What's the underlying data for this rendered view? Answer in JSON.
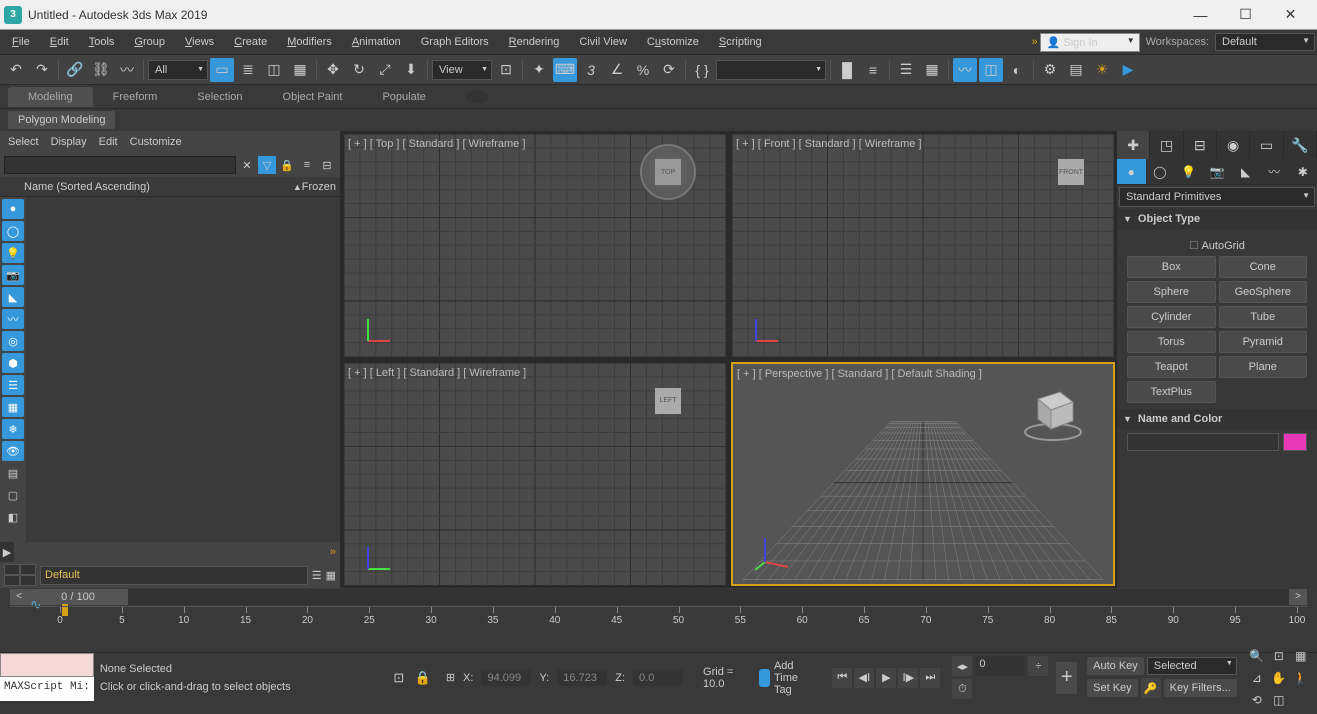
{
  "title": "Untitled - Autodesk 3ds Max 2019",
  "app_icon_text": "3",
  "menu": [
    "File",
    "Edit",
    "Tools",
    "Group",
    "Views",
    "Create",
    "Modifiers",
    "Animation",
    "Graph Editors",
    "Rendering",
    "Civil View",
    "Customize",
    "Scripting"
  ],
  "sign_in": "Sign In",
  "workspace_label": "Workspaces:",
  "workspace_value": "Default",
  "main_toolbar": {
    "all_dropdown": "All",
    "view_dropdown": "View"
  },
  "ribbon_tabs": [
    "Modeling",
    "Freeform",
    "Selection",
    "Object Paint",
    "Populate"
  ],
  "sub_ribbon": "Polygon Modeling",
  "scene_explorer": {
    "menu": [
      "Select",
      "Display",
      "Edit",
      "Customize"
    ],
    "header_col": "Name (Sorted Ascending)",
    "header_frozen": "Frozen",
    "layer_default": "Default"
  },
  "viewports": {
    "top": "[ + ] [ Top ] [ Standard ] [ Wireframe ]",
    "front": "[ + ] [ Front ] [ Standard ] [ Wireframe ]",
    "left": "[ + ] [ Left ] [ Standard ] [ Wireframe ]",
    "persp": "[ + ] [ Perspective ] [ Standard ] [ Default Shading ]",
    "cube_top": "TOP",
    "cube_front": "FRONT",
    "cube_left": "LEFT"
  },
  "command_panel": {
    "category": "Standard Primitives",
    "rollout_object_type": "Object Type",
    "autogrid": "AutoGrid",
    "buttons": [
      "Box",
      "Cone",
      "Sphere",
      "GeoSphere",
      "Cylinder",
      "Tube",
      "Torus",
      "Pyramid",
      "Teapot",
      "Plane",
      "TextPlus"
    ],
    "rollout_name_color": "Name and Color"
  },
  "timeline": {
    "slider_label": "0 / 100",
    "ticks": [
      0,
      5,
      10,
      15,
      20,
      25,
      30,
      35,
      40,
      45,
      50,
      55,
      60,
      65,
      70,
      75,
      80,
      85,
      90,
      95,
      100
    ]
  },
  "status": {
    "maxscript": "MAXScript Mi:",
    "none_selected": "None Selected",
    "prompt": "Click or click-and-drag to select objects",
    "x_label": "X:",
    "x_value": "94.099",
    "y_label": "Y:",
    "y_value": "16.723",
    "z_label": "Z:",
    "z_value": "0.0",
    "grid_label": "Grid = 10.0",
    "add_time_tag": "Add Time Tag",
    "frame_value": "0",
    "auto_key": "Auto Key",
    "set_key": "Set Key",
    "selected": "Selected",
    "key_filters": "Key Filters..."
  }
}
